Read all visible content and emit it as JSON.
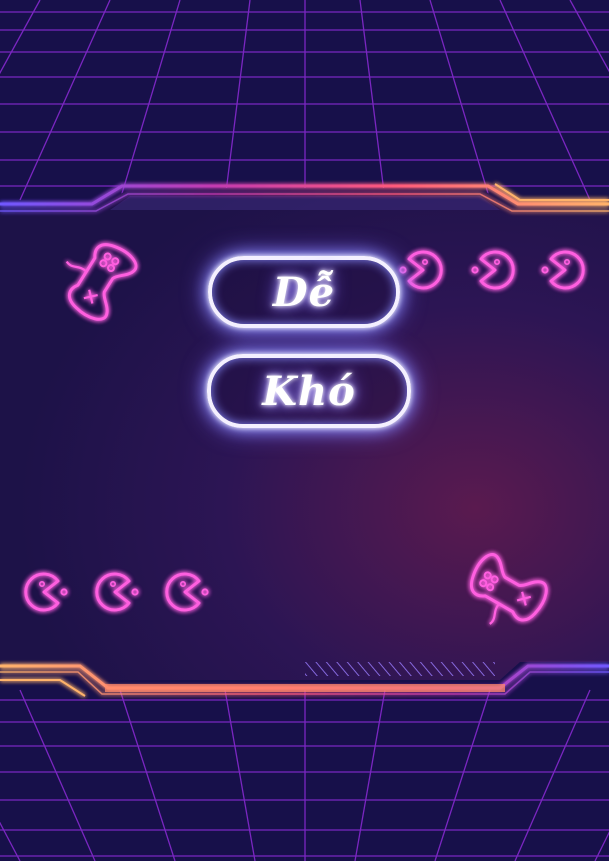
{
  "menu": {
    "easy_label": "Dễ",
    "hard_label": "Khó"
  },
  "decor": {
    "top_right_icons": [
      "pacman-icon",
      "pacman-icon",
      "pacman-icon"
    ],
    "bottom_left_icons": [
      "pacman-icon",
      "pacman-icon",
      "pacman-icon"
    ],
    "controller_icons": [
      "gamepad-icon",
      "gamepad-icon"
    ]
  },
  "colors": {
    "neon_pink": "#ff4fd8",
    "neon_white": "#f4f0ff",
    "frame_orange": "#ffb36b",
    "frame_purple": "#7b55ff",
    "grid_line": "#8a2be2",
    "background": "#160f44"
  }
}
